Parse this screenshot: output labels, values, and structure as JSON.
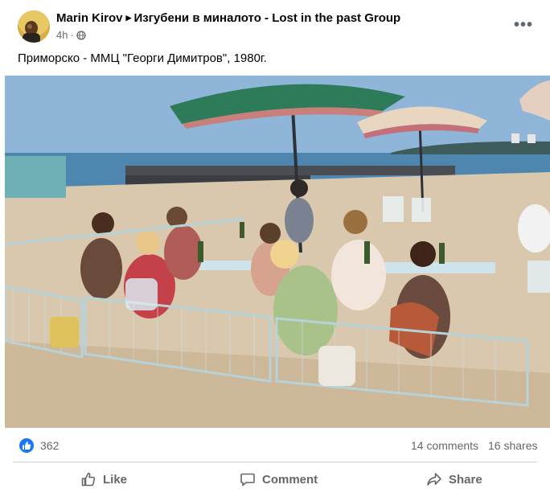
{
  "post": {
    "author": "Marin Kirov",
    "group": "Изгубени в миналото - Lost in the past Group",
    "time": "4h",
    "audience_icon": "globe-icon",
    "caption": "Приморско - ММЦ \"Георги Димитров\", 1980г."
  },
  "stats": {
    "reaction_icon": "like-icon",
    "reactions": "362",
    "comments": "14 comments",
    "shares": "16 shares"
  },
  "actions": {
    "like": "Like",
    "comment": "Comment",
    "share": "Share"
  },
  "colors": {
    "accent": "#1877f2",
    "secondary_text": "#65676b",
    "divider": "#ced0d4"
  }
}
